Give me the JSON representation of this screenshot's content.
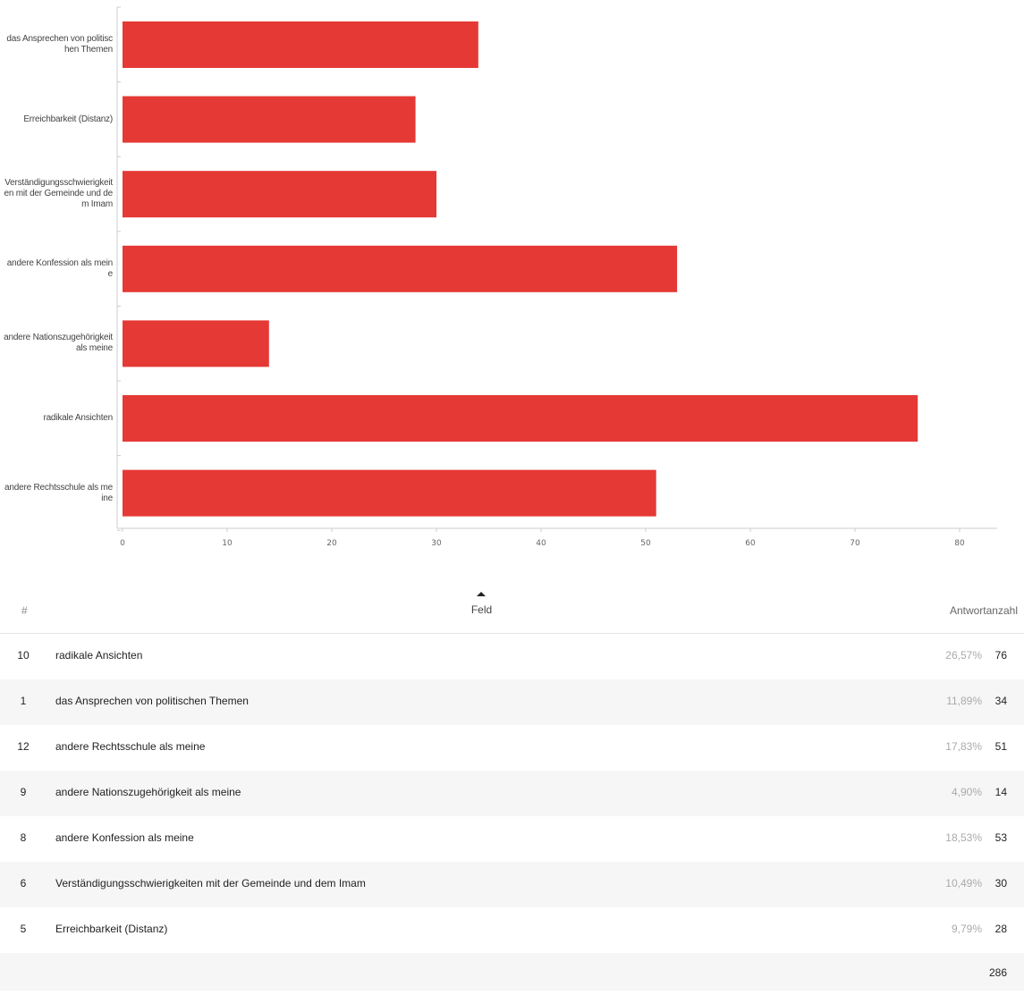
{
  "chart_data": {
    "type": "bar",
    "orientation": "horizontal",
    "categories": [
      "das Ansprechen von politischen Themen",
      "Erreichbarkeit (Distanz)",
      "Verständigungsschwierigkeiten mit der Gemeinde und dem Imam",
      "andere Konfession als meine",
      "andere Nationszugehörigkeit als meine",
      "radikale Ansichten",
      "andere Rechtsschule als meine"
    ],
    "values": [
      34,
      28,
      30,
      53,
      14,
      76,
      51
    ],
    "xlim": [
      0,
      80
    ],
    "xticks": [
      0,
      10,
      20,
      30,
      40,
      50,
      60,
      70,
      80
    ],
    "bar_color": "#e53935",
    "grid": false
  },
  "table": {
    "headers": {
      "id": "#",
      "field": "Feld",
      "count": "Antwortanzahl"
    },
    "rows": [
      {
        "id": "10",
        "field": "radikale Ansichten",
        "pct": "26,57%",
        "count": "76"
      },
      {
        "id": "1",
        "field": "das Ansprechen von politischen Themen",
        "pct": "11,89%",
        "count": "34"
      },
      {
        "id": "12",
        "field": "andere Rechtsschule als meine",
        "pct": "17,83%",
        "count": "51"
      },
      {
        "id": "9",
        "field": "andere Nationszugehörigkeit als meine",
        "pct": "4,90%",
        "count": "14"
      },
      {
        "id": "8",
        "field": "andere Konfession als meine",
        "pct": "18,53%",
        "count": "53"
      },
      {
        "id": "6",
        "field": "Verständigungsschwierigkeiten mit der Gemeinde und dem Imam",
        "pct": "10,49%",
        "count": "30"
      },
      {
        "id": "5",
        "field": "Erreichbarkeit (Distanz)",
        "pct": "9,79%",
        "count": "28"
      }
    ],
    "total": "286"
  }
}
